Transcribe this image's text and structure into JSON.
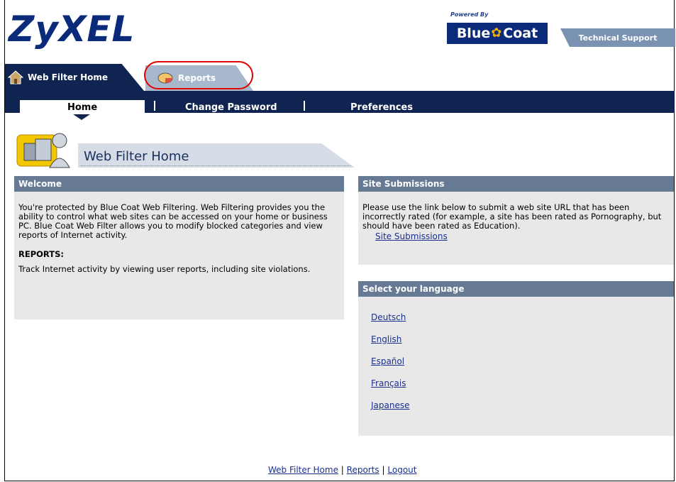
{
  "brand": {
    "logo_text": "ZyXEL",
    "powered_by": "Powered By",
    "partner": "Blue Coat"
  },
  "header": {
    "tech_support": "Technical Support"
  },
  "tabs": [
    {
      "label": "Web Filter Home",
      "active": true
    },
    {
      "label": "Reports",
      "active": false
    }
  ],
  "subnav": {
    "items": [
      {
        "label": "Home",
        "active": true
      },
      {
        "label": "Change Password"
      },
      {
        "label": "Preferences"
      }
    ]
  },
  "page": {
    "title": "Web Filter Home"
  },
  "welcome": {
    "heading": "Welcome",
    "body": "You're protected by Blue Coat Web Filtering. Web Filtering provides you the ability to control what web sites can be accessed on your home or business PC. Blue Coat Web Filter allows you to modify blocked categories and view reports of Internet activity.",
    "reports_heading": "REPORTS:",
    "reports_body": "Track Internet activity by viewing user reports, including site violations."
  },
  "site_submissions": {
    "heading": "Site Submissions",
    "body": "Please use the link below to submit a web site URL that has been incorrectly rated (for example, a site has been rated as Pornography, but should have been rated as Education).",
    "link": "Site Submissions"
  },
  "language": {
    "heading": "Select your language",
    "options": [
      "Deutsch",
      "English",
      "Español",
      "Français",
      "Japanese"
    ]
  },
  "footer": {
    "links": [
      "Web Filter Home",
      "Reports",
      "Logout"
    ],
    "separator": "|"
  },
  "colors": {
    "navy": "#0f2450",
    "panel_header": "#677a94",
    "highlight": "#e00000"
  }
}
